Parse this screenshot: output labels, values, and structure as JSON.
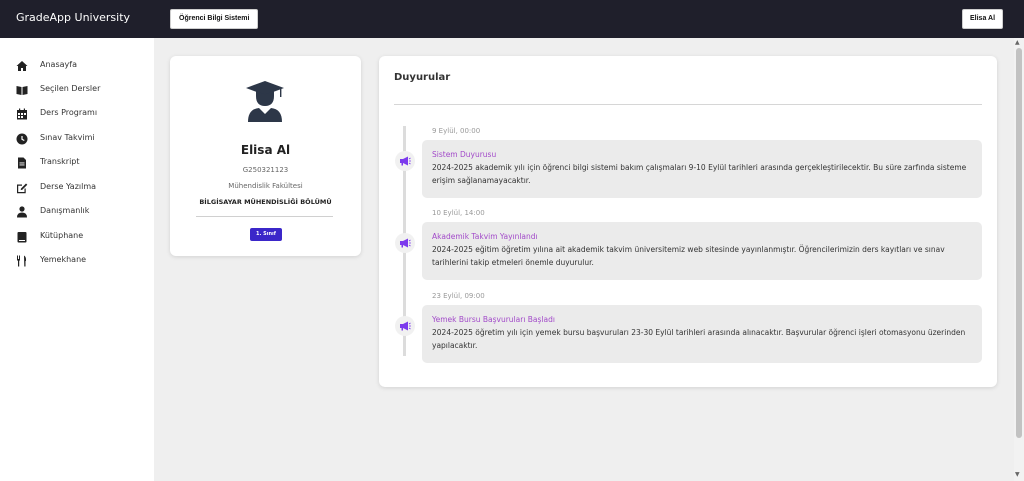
{
  "header": {
    "brand": "GradeApp University",
    "system_button": "Öğrenci Bilgi Sistemi",
    "user_button": "Elisa Al"
  },
  "sidebar": {
    "items": [
      {
        "label": "Anasayfa",
        "icon": "home-icon"
      },
      {
        "label": "Seçilen Dersler",
        "icon": "book-icon"
      },
      {
        "label": "Ders Programı",
        "icon": "calendar-icon"
      },
      {
        "label": "Sınav Takvimi",
        "icon": "clock-icon"
      },
      {
        "label": "Transkript",
        "icon": "document-icon"
      },
      {
        "label": "Derse Yazılma",
        "icon": "edit-icon"
      },
      {
        "label": "Danışmanlık",
        "icon": "advisor-icon"
      },
      {
        "label": "Kütüphane",
        "icon": "library-icon"
      },
      {
        "label": "Yemekhane",
        "icon": "utensils-icon"
      }
    ]
  },
  "profile": {
    "name": "Elisa Al",
    "student_id": "G250321123",
    "faculty": "Mühendislik Fakültesi",
    "department": "BİLGİSAYAR MÜHENDİSLİĞİ BÖLÜMÜ",
    "grade_badge": "1. Sınıf"
  },
  "announcements": {
    "title": "Duyurular",
    "items": [
      {
        "date": "9 Eylül, 00:00",
        "title": "Sistem Duyurusu",
        "body": "2024-2025 akademik yılı için öğrenci bilgi sistemi bakım çalışmaları 9-10 Eylül tarihleri arasında gerçekleştirilecektir. Bu süre zarfında sisteme erişim sağlanamayacaktır."
      },
      {
        "date": "10 Eylül, 14:00",
        "title": "Akademik Takvim Yayınlandı",
        "body": "2024-2025 eğitim öğretim yılına ait akademik takvim üniversitemiz web sitesinde yayınlanmıştır. Öğrencilerimizin ders kayıtları ve sınav tarihlerini takip etmeleri önemle duyurulur."
      },
      {
        "date": "23 Eylül, 09:00",
        "title": "Yemek Bursu Başvuruları Başladı",
        "body": "2024-2025 öğretim yılı için yemek bursu başvuruları 23-30 Eylül tarihleri arasında alınacaktır. Başvurular öğrenci işleri otomasyonu üzerinden yapılacaktır."
      }
    ]
  },
  "colors": {
    "topbar": "#1f1f2b",
    "accent_purple": "#a24ac9",
    "badge": "#3b27c9",
    "marker_icon": "#7c3aed"
  }
}
